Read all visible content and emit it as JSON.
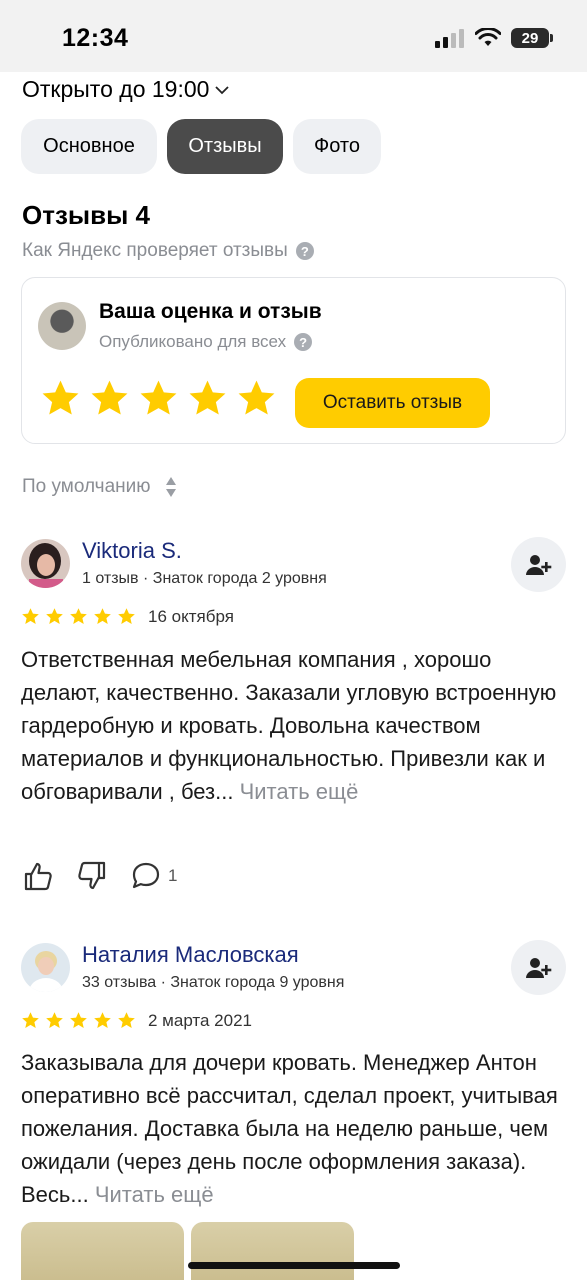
{
  "status_bar": {
    "time": "12:34",
    "battery": "29"
  },
  "business": {
    "hours": "Открыто до 19:00"
  },
  "tabs": [
    {
      "label": "Основное",
      "active": false
    },
    {
      "label": "Отзывы",
      "active": true
    },
    {
      "label": "Фото",
      "active": false
    }
  ],
  "reviews_section": {
    "title": "Отзывы 4",
    "verify_text": "Как Яндекс проверяет отзывы"
  },
  "rate_card": {
    "title": "Ваша оценка и отзыв",
    "subtitle": "Опубликовано для всех",
    "stars": 5,
    "button_label": "Оставить отзыв",
    "accent_color": "#ffcc00"
  },
  "sort": {
    "label": "По умолчанию"
  },
  "reviews": [
    {
      "name": "Viktoria S.",
      "meta": "1 отзыв · Знаток города 2 уровня",
      "rating": 5,
      "date": "16 октября",
      "text": "Ответственная мебельная компания , хорошо делают, качественно. Заказали угловую встроенную гардеробную и кровать. Довольна качеством материалов и функциональностью. Привезли как и обговаривали , без...",
      "read_more": "Читать ещё",
      "comments": "1"
    },
    {
      "name": "Наталия Масловская",
      "meta": "33 отзыва · Знаток города 9 уровня",
      "rating": 5,
      "date": "2 марта 2021",
      "text": "Заказывала для дочери кровать. Менеджер Антон оперативно всё рассчитал, сделал проект, учитывая пожелания. Доставка была на неделю раньше, чем ожидали (через день после оформления заказа). Весь...",
      "read_more": "Читать ещё"
    }
  ],
  "colors": {
    "star": "#ffcc00",
    "name_link": "#1a2a7a",
    "muted": "#8a8d93"
  }
}
